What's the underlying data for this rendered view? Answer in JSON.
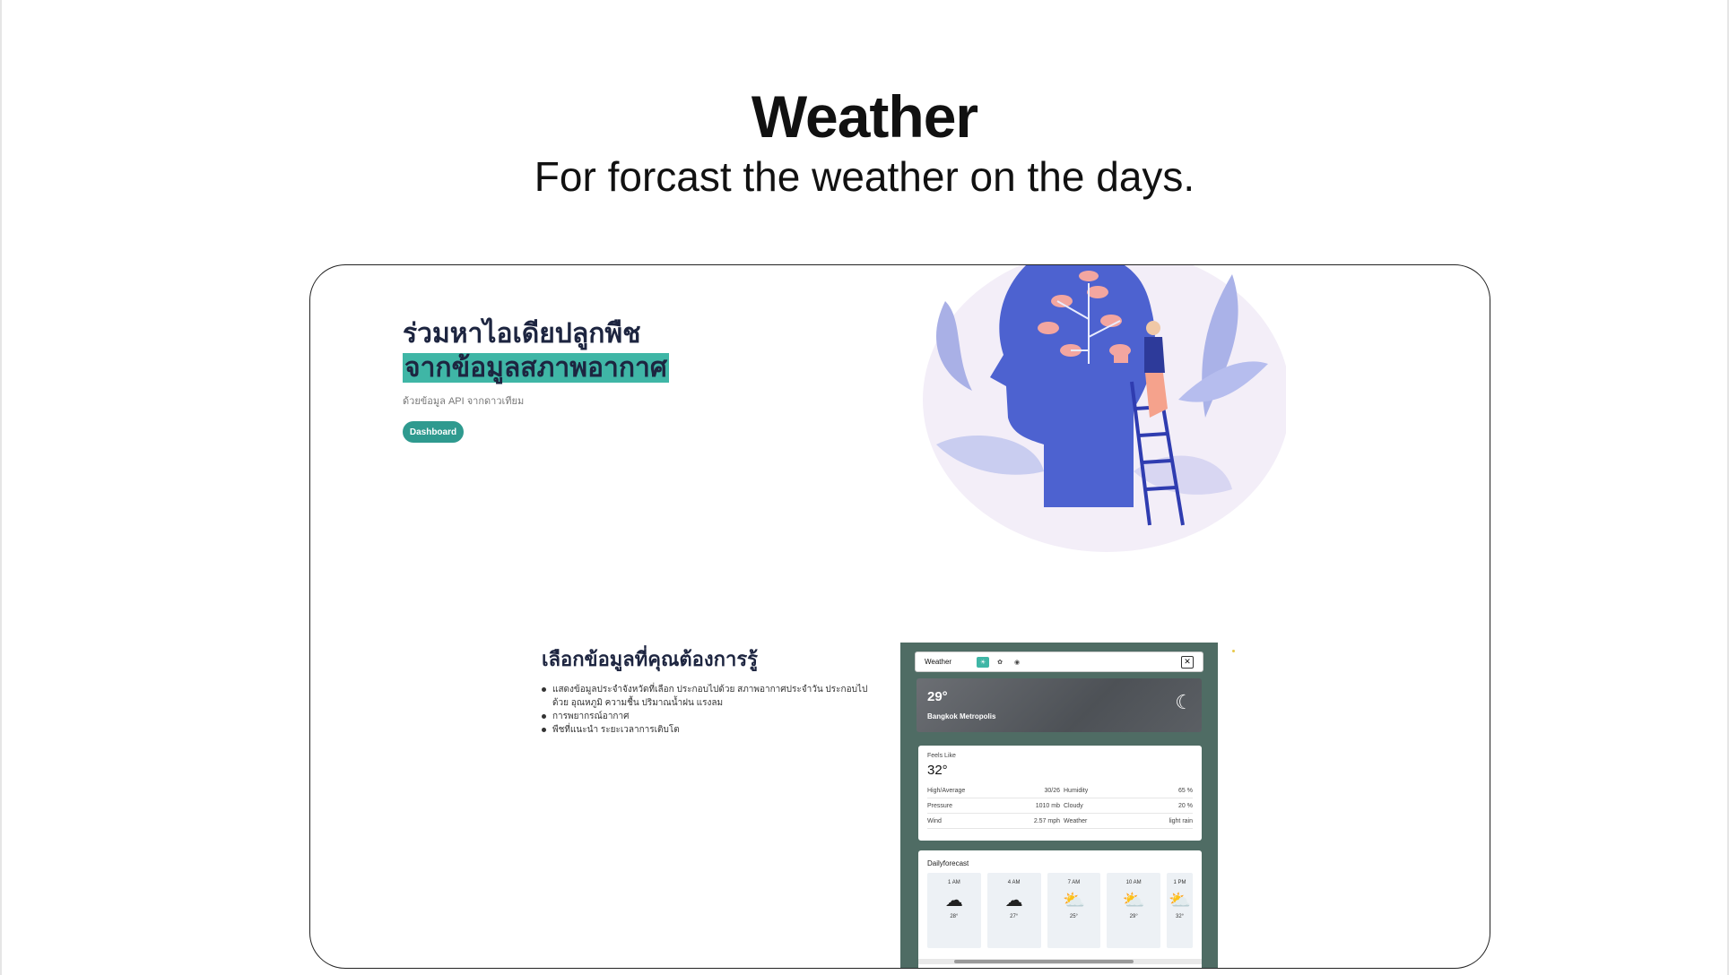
{
  "hero": {
    "title": "Weather",
    "subtitle": "For forcast the weather on the days."
  },
  "landing": {
    "headline_line1": "ร่วมหาไอเดียปลูกพืช",
    "headline_line2": "จากข้อมูลสภาพอากาศ",
    "subtext": "ด้วยข้อมูล API จากดาวเทียม",
    "dashboard_button": "Dashboard",
    "accent_color": "#3fb6a6"
  },
  "features": {
    "title": "เลือกข้อมูลที่คุณต้องการรู้",
    "items": [
      "แสดงข้อมูลประจำจังหวัดที่เลือก ประกอบไปด้วย สภาพอากาศประจำวัน ประกอบไปด้วย อุณหภูมิ ความชื้น ปริมาณน้ำฝน แรงลม",
      "การพยากรณ์อากาศ",
      "พืชที่แนะนำ ระยะเวลาการเติบโต"
    ]
  },
  "app_preview": {
    "nav_title": "Weather",
    "nav_icons": [
      "sun-icon",
      "plant-icon",
      "globe-icon"
    ],
    "close_glyph": "✕",
    "current_temp": "29°",
    "city": "Bangkok Metropolis",
    "weather_icon": "night-rain-icon",
    "feels_like_label": "Feels Like",
    "feels_like_value": "32°",
    "details": [
      {
        "l1": "High/Average",
        "v1": "30/26",
        "l2": "Humidity",
        "v2": "65 %"
      },
      {
        "l1": "Pressure",
        "v1": "1010 mb",
        "l2": "Cloudy",
        "v2": "20 %"
      },
      {
        "l1": "Wind",
        "v1": "2.57 mph",
        "l2": "Weather",
        "v2": "light rain"
      }
    ],
    "forecast_title": "Dailyforecast",
    "forecast": [
      {
        "time": "1 AM",
        "icon": "cloud-moon-icon",
        "temp": "28°"
      },
      {
        "time": "4 AM",
        "icon": "cloud-moon-icon",
        "temp": "27°"
      },
      {
        "time": "7 AM",
        "icon": "cloud-sun-icon",
        "temp": "25°"
      },
      {
        "time": "10 AM",
        "icon": "cloud-sun-icon",
        "temp": "29°"
      },
      {
        "time": "1 PM",
        "icon": "cloud-sun-icon",
        "temp": "32°"
      }
    ]
  }
}
